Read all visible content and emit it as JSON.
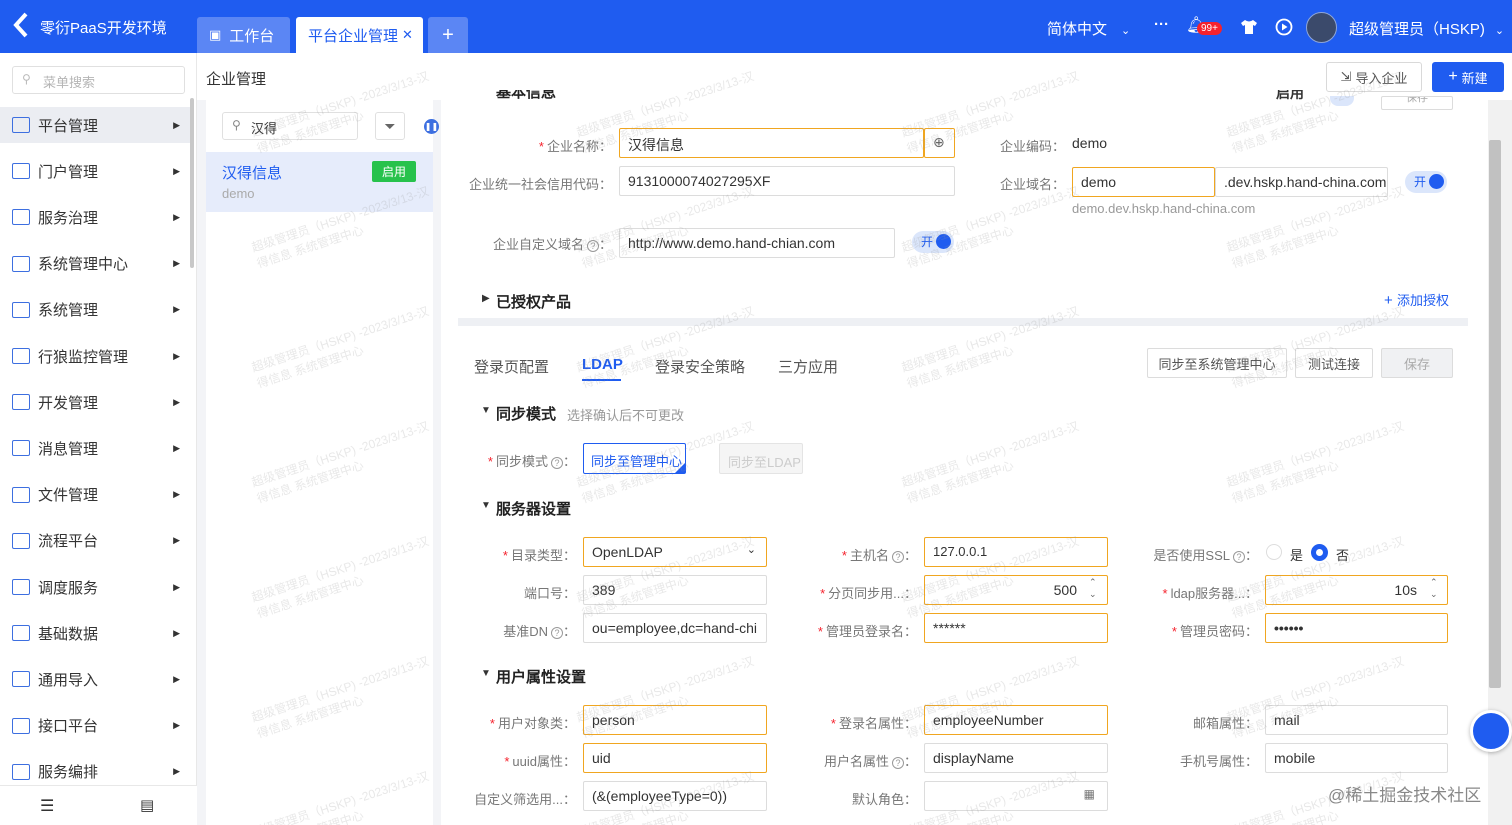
{
  "header": {
    "app_title": "零衍PaaS开发环境",
    "tabs": [
      {
        "label": "工作台"
      },
      {
        "label": "平台企业管理"
      }
    ],
    "add_tab": "+",
    "language": "简体中文",
    "more": "···",
    "notify_badge": "99+",
    "user": "超级管理员（HSKP)"
  },
  "sidebar": {
    "search_placeholder": "菜单搜索",
    "items": [
      {
        "label": "平台管理"
      },
      {
        "label": "门户管理"
      },
      {
        "label": "服务治理"
      },
      {
        "label": "系统管理中心"
      },
      {
        "label": "系统管理"
      },
      {
        "label": "行狼监控管理"
      },
      {
        "label": "开发管理"
      },
      {
        "label": "消息管理"
      },
      {
        "label": "文件管理"
      },
      {
        "label": "流程平台"
      },
      {
        "label": "调度服务"
      },
      {
        "label": "基础数据"
      },
      {
        "label": "通用导入"
      },
      {
        "label": "接口平台"
      },
      {
        "label": "服务编排"
      }
    ]
  },
  "breadcrumb": "企业管理",
  "toolbar": {
    "import": "导入企业",
    "new": "新建"
  },
  "list": {
    "search_value": "汉得",
    "item": {
      "name": "汉得信息",
      "code": "demo",
      "status": "启用"
    }
  },
  "basic": {
    "section_partial": "基本信息",
    "status_partial": "启用",
    "save_partial": "保存",
    "name_label": "企业名称",
    "name_value": "汉得信息",
    "code_label": "企业编码",
    "code_value": "demo",
    "credit_label": "企业统一社会信用代码",
    "credit_value": "9131000074027295XF",
    "domain_label": "企业域名",
    "domain_value": "demo",
    "domain_suffix": ".dev.hskp.hand-china.com",
    "domain_hint": "demo.dev.hskp.hand-china.com",
    "domain_switch": "开",
    "custom_domain_label": "企业自定义域名",
    "custom_domain_value": "http://www.demo.hand-chian.com",
    "custom_switch": "开"
  },
  "authorized": {
    "title": "已授权产品",
    "add": "添加授权"
  },
  "tabs": [
    {
      "label": "登录页配置"
    },
    {
      "label": "LDAP"
    },
    {
      "label": "登录安全策略"
    },
    {
      "label": "三方应用"
    }
  ],
  "ldap_actions": {
    "sync": "同步至系统管理中心",
    "test": "测试连接",
    "save": "保存"
  },
  "sync_mode": {
    "title": "同步模式",
    "hint": "选择确认后不可更改",
    "label": "同步模式",
    "option1": "同步至管理中心",
    "option2": "同步至LDAP"
  },
  "server": {
    "title": "服务器设置",
    "dir_type_label": "目录类型",
    "dir_type_value": "OpenLDAP",
    "host_label": "主机名",
    "host_value": "127.0.0.1",
    "ssl_label": "是否使用SSL",
    "ssl_yes": "是",
    "ssl_no": "否",
    "port_label": "端口号",
    "port_value": "389",
    "page_label": "分页同步用...",
    "page_value": "500",
    "ldap_timeout_label": "ldap服务器...",
    "ldap_timeout_value": "10s",
    "base_dn_label": "基准DN",
    "base_dn_value": "ou=employee,dc=hand-chi",
    "admin_login_label": "管理员登录名",
    "admin_login_value": "******",
    "admin_pwd_label": "管理员密码",
    "admin_pwd_value": "••••••"
  },
  "user_attr": {
    "title": "用户属性设置",
    "obj_class_label": "用户对象类",
    "obj_class_value": "person",
    "login_attr_label": "登录名属性",
    "login_attr_value": "employeeNumber",
    "mail_label": "邮箱属性",
    "mail_value": "mail",
    "uuid_label": "uuid属性",
    "uuid_value": "uid",
    "username_label": "用户名属性",
    "username_value": "displayName",
    "phone_label": "手机号属性",
    "phone_value": "mobile",
    "filter_label": "自定义筛选用...",
    "filter_value": "(&(employeeType=0))",
    "role_label": "默认角色"
  },
  "watermark": {
    "line1": "超级管理员（HSKP) -2023/3/13-汉",
    "line2": "得信息 系统管理中心"
  },
  "footer_mark": "@稀土掘金技术社区",
  "colors": {
    "primary": "#1f5cf0",
    "header_bg": "#1f5cf0",
    "success": "#27c24c",
    "required": "#f5222d",
    "highlight_border": "#f0a620"
  }
}
